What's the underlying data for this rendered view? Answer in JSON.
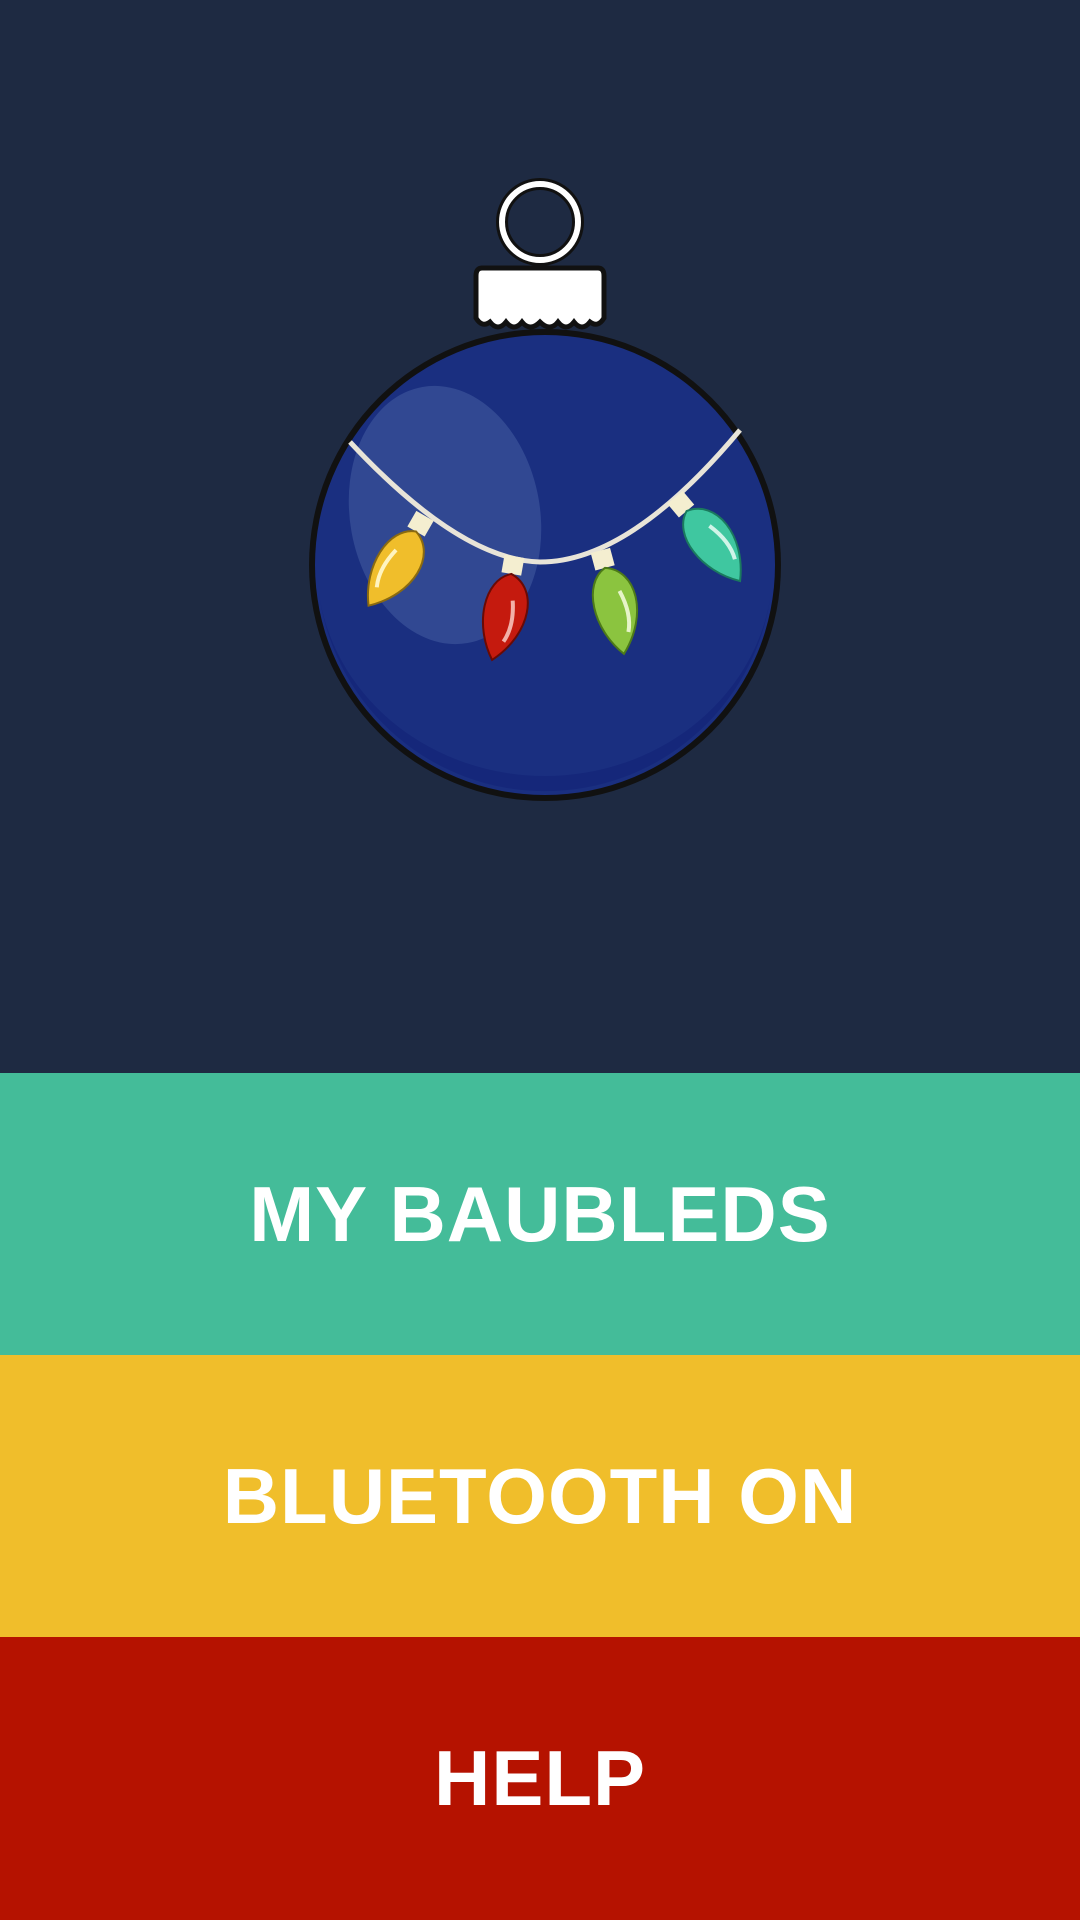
{
  "menu": {
    "items": [
      {
        "label": "MY BAUBLEDS",
        "color": "#44bc99"
      },
      {
        "label": "BLUETOOTH ON",
        "color": "#f0be2b"
      },
      {
        "label": "HELP",
        "color": "#b51200"
      }
    ]
  },
  "hero": {
    "background_color": "#1e2a42",
    "illustration": "christmas-bauble-icon",
    "bauble_color": "#1a2f80",
    "light_colors": [
      "#f0be2b",
      "#c51a0e",
      "#8bc43f",
      "#3fc7a0"
    ]
  }
}
